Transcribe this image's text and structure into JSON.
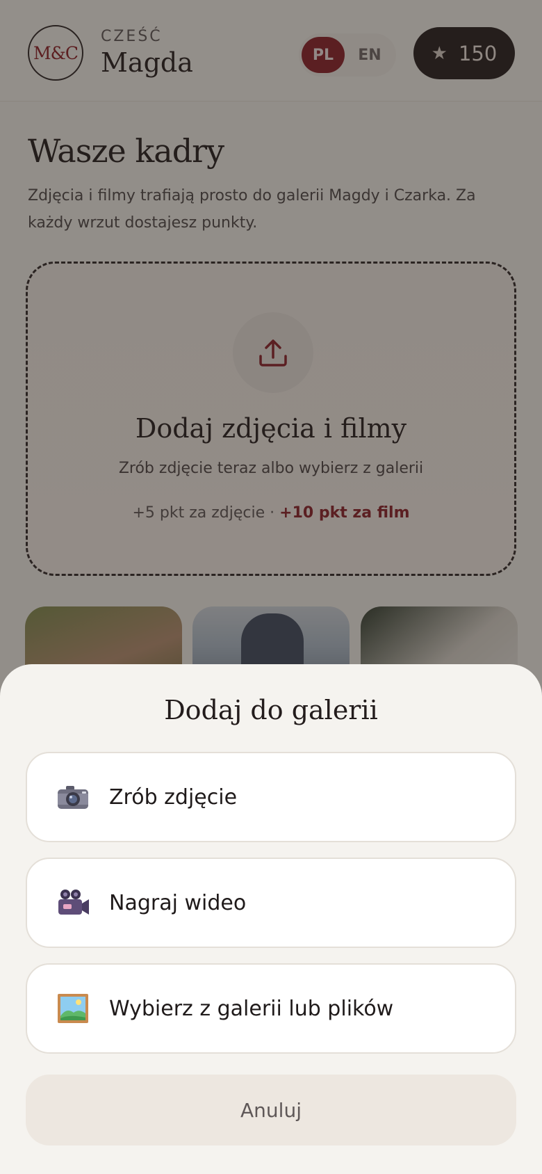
{
  "header": {
    "monogram": "M&C",
    "greeting_label": "CZEŚĆ",
    "greeting_name": "Magda",
    "languages": [
      {
        "code": "PL",
        "active": true
      },
      {
        "code": "EN",
        "active": false
      }
    ],
    "points": "150",
    "points_icon": "star-icon"
  },
  "main": {
    "title": "Wasze kadry",
    "subtitle": "Zdjęcia i filmy trafiają prosto do galerii Magdy i Czarka. Za każdy wrzut dostajesz punkty.",
    "dropzone": {
      "icon": "upload-icon",
      "title": "Dodaj zdjęcia i filmy",
      "subtitle": "Zrób zdjęcie teraz albo wybierz z galerii",
      "points_photo": "+5 pkt za zdjęcie",
      "separator": " · ",
      "points_video": "+10 pkt za film"
    }
  },
  "sheet": {
    "title": "Dodaj do galerii",
    "options": [
      {
        "label": "Zrób zdjęcie",
        "icon": "camera-icon"
      },
      {
        "label": "Nagraj wideo",
        "icon": "video-camera-icon"
      },
      {
        "label": "Wybierz z galerii lub plików",
        "icon": "picture-icon"
      }
    ],
    "cancel_label": "Anuluj"
  },
  "colors": {
    "accent": "#8a1d27",
    "dark": "#231b1b",
    "background": "#f4f1ec"
  }
}
